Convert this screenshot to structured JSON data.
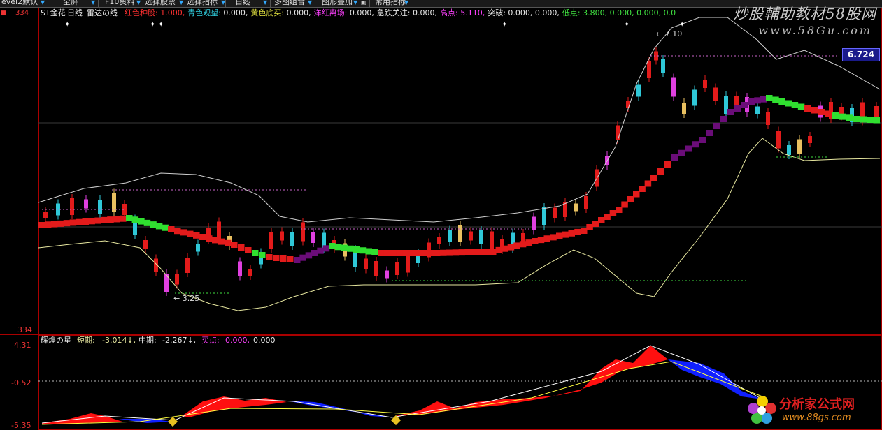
{
  "toolbar": {
    "items": [
      "evel2默认",
      "全屏",
      "F10资料",
      "选择股票",
      "选择指标",
      "日线",
      "多图组合",
      "图形叠加",
      "常用指标"
    ]
  },
  "main_panel": {
    "stock_name": "ST金花",
    "period": "日线",
    "indicator": "雷达の线",
    "legend": [
      {
        "text": "红色种股:",
        "value": "1.000,",
        "color": "#ff3030"
      },
      {
        "text": "青色观望:",
        "value": "0.000,",
        "color": "#30d0e0"
      },
      {
        "text": "黄色底买:",
        "value": "0.000,",
        "color": "#e0e040"
      },
      {
        "text": "洋红离场:",
        "value": "0.000,",
        "color": "#ff40ff"
      },
      {
        "text": "急跌关注:",
        "value": "0.000,",
        "color": "#e8e8e8"
      },
      {
        "text": "高点:",
        "value": "5.110,",
        "color": "#ff40ff"
      },
      {
        "text": "突破:",
        "value": "0.000, 0.000,",
        "color": "#e8e8e8"
      },
      {
        "text": "低点:",
        "value": "3.800, 0.000, 0.000, 0.0",
        "color": "#40e040"
      }
    ],
    "top_axis_label": "334",
    "bottom_axis_label": "334",
    "high_annotation": "7.10",
    "low_annotation": "3.25",
    "price_tag": "6.724"
  },
  "sub_panel": {
    "title": "辉煌の星",
    "short_label": "短期:",
    "short_value": "-3.014↓,",
    "mid_label": "中期:",
    "mid_value": "-2.267↓,",
    "buy_label": "买点:",
    "buy_value": "0.000,",
    "extra_value": "0.000",
    "axis": [
      "4.31",
      "-0.52",
      "-5.35"
    ]
  },
  "watermarks": {
    "top": "炒股輔助教材58股网",
    "top_url": "www.58Gu.com",
    "brand": "分析家公式网",
    "brand_url": "www.88gs.com"
  },
  "colors": {
    "up": "#e31b1b",
    "down": "#2fc8d8",
    "magenta": "#e040e0",
    "yellow": "#e8c060",
    "green": "#30e030",
    "purple": "#6a0d78",
    "blue": "#1020ff"
  }
}
